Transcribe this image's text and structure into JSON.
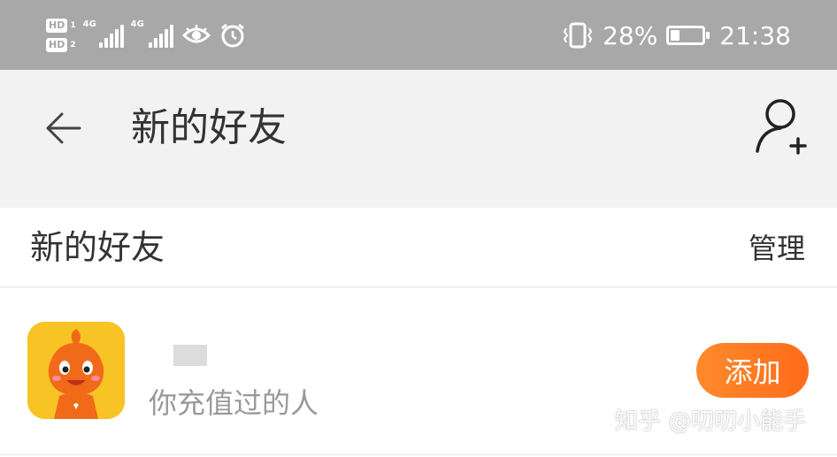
{
  "status_bar": {
    "hd1_label": "HD",
    "hd1_sub": "1",
    "hd2_label": "HD",
    "hd2_sub": "2",
    "sig1_label": "4G",
    "sig2_label": "4G",
    "battery_percent": "28%",
    "battery_level": 0.28,
    "time": "21:38",
    "icons": [
      "vibrate-icon",
      "eye-icon",
      "alarm-icon",
      "battery-icon"
    ]
  },
  "app_bar": {
    "title": "新的好友",
    "back_icon": "back-arrow-icon",
    "action_icon": "add-friend-icon"
  },
  "section": {
    "title": "新的好友",
    "manage_label": "管理"
  },
  "friends": [
    {
      "subtitle": "你充值过的人",
      "add_label": "添加"
    }
  ],
  "watermark": "知乎 @叨叨小能手",
  "colors": {
    "accent": "#ff7a22",
    "status_bar": "#a8a8a8"
  }
}
